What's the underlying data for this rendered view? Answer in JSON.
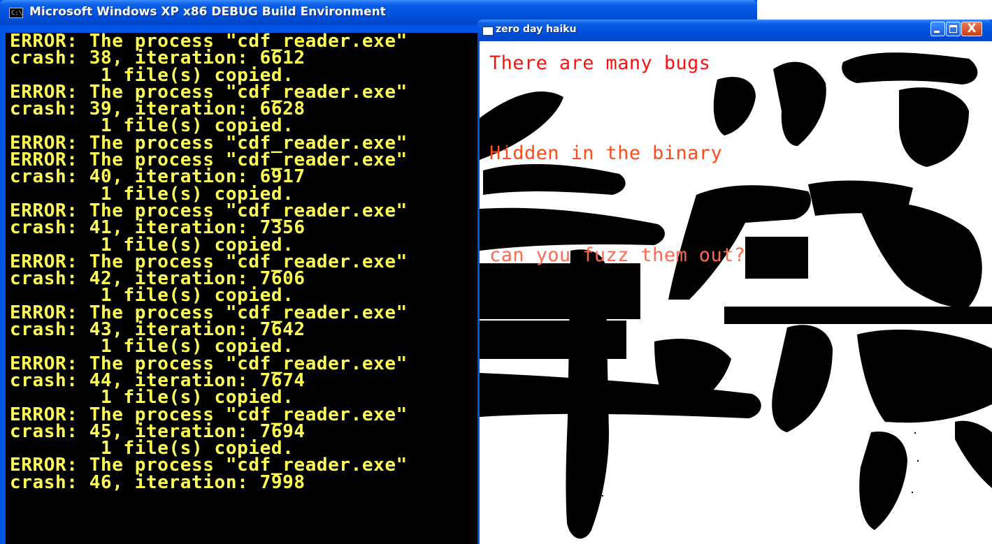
{
  "console": {
    "title": "Microsoft Windows XP x86 DEBUG Build Environment",
    "icon": "command-prompt-icon",
    "text_color": "#ffff55",
    "background": "#000000",
    "lines": [
      {
        "text": "ERROR: The process \"cdf_reader.exe\"",
        "kind": "error"
      },
      {
        "text": "crash: 38, iteration: 6612",
        "kind": "crash"
      },
      {
        "text": "        1 file(s) copied.",
        "kind": "copied"
      },
      {
        "text": "ERROR: The process \"cdf_reader.exe\"",
        "kind": "error"
      },
      {
        "text": "crash: 39, iteration: 6628",
        "kind": "crash"
      },
      {
        "text": "        1 file(s) copied.",
        "kind": "copied"
      },
      {
        "text": "ERROR: The process \"cdf_reader.exe\"",
        "kind": "error"
      },
      {
        "text": "ERROR: The process \"cdf_reader.exe\"",
        "kind": "error"
      },
      {
        "text": "crash: 40, iteration: 6917",
        "kind": "crash"
      },
      {
        "text": "        1 file(s) copied.",
        "kind": "copied"
      },
      {
        "text": "ERROR: The process \"cdf_reader.exe\"",
        "kind": "error"
      },
      {
        "text": "crash: 41, iteration: 7356",
        "kind": "crash"
      },
      {
        "text": "        1 file(s) copied.",
        "kind": "copied"
      },
      {
        "text": "ERROR: The process \"cdf_reader.exe\"",
        "kind": "error"
      },
      {
        "text": "crash: 42, iteration: 7606",
        "kind": "crash"
      },
      {
        "text": "        1 file(s) copied.",
        "kind": "copied"
      },
      {
        "text": "ERROR: The process \"cdf_reader.exe\"",
        "kind": "error"
      },
      {
        "text": "crash: 43, iteration: 7642",
        "kind": "crash"
      },
      {
        "text": "        1 file(s) copied.",
        "kind": "copied"
      },
      {
        "text": "ERROR: The process \"cdf_reader.exe\"",
        "kind": "error"
      },
      {
        "text": "crash: 44, iteration: 7674",
        "kind": "crash"
      },
      {
        "text": "        1 file(s) copied.",
        "kind": "copied"
      },
      {
        "text": "ERROR: The process \"cdf_reader.exe\"",
        "kind": "error"
      },
      {
        "text": "crash: 45, iteration: 7694",
        "kind": "crash"
      },
      {
        "text": "        1 file(s) copied.",
        "kind": "copied"
      },
      {
        "text": "ERROR: The process \"cdf_reader.exe\"",
        "kind": "error"
      },
      {
        "text": "crash: 46, iteration: 7998",
        "kind": "crash"
      }
    ]
  },
  "haiku_window": {
    "title": "zero day haiku",
    "icon": "application-window-icon",
    "buttons": {
      "minimize_icon": "minimize-icon",
      "maximize_icon": "maximize-icon",
      "close_icon": "close-icon"
    },
    "close_glyph": "X",
    "lines": [
      {
        "text": "There are many bugs",
        "color": "#ff1010"
      },
      {
        "text": "Hidden in the binary",
        "color": "#ff4a1a"
      },
      {
        "text": "can you fuzz them out?",
        "color": "#ff6a50"
      }
    ],
    "background_art": "black kanji calligraphy brush strokes on white"
  },
  "colors": {
    "xp_titlebar_blue": "#0054e3",
    "console_text": "#ffff55"
  }
}
